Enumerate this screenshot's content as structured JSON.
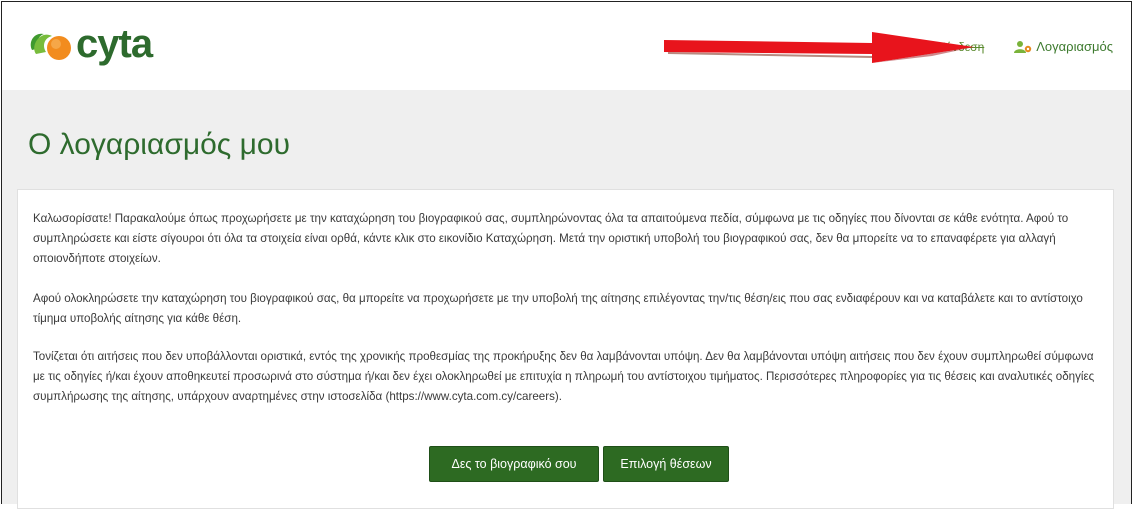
{
  "header": {
    "logo_text": "cyta",
    "struck_link": "Σύνδεση",
    "account_label": "Λογαριασμός"
  },
  "main": {
    "title": "Ο λογαριασμός μου",
    "paragraphs": [
      "Καλωσορίσατε! Παρακαλούμε όπως προχωρήσετε με την καταχώρηση του βιογραφικού σας, συμπληρώνοντας όλα τα απαιτούμενα πεδία, σύμφωνα με τις οδηγίες που δίνονται σε κάθε ενότητα. Αφού το συμπληρώσετε και είστε σίγουροι ότι όλα τα στοιχεία είναι ορθά, κάντε κλικ στο εικονίδιο Καταχώρηση. Μετά την οριστική υποβολή του βιογραφικού σας, δεν θα μπορείτε να το επαναφέρετε για αλλαγή οποιονδήποτε στοιχείων.",
      "Αφού ολοκληρώσετε την καταχώρηση του βιογραφικού σας, θα μπορείτε να προχωρήσετε με την υποβολή της αίτησης επιλέγοντας την/τις θέση/εις που σας ενδιαφέρουν και να καταβάλετε και το αντίστοιχο τίμημα υποβολής αίτησης για κάθε θέση.",
      "Τονίζεται ότι αιτήσεις που δεν υποβάλλονται οριστικά, εντός της χρονικής προθεσμίας της προκήρυξης δεν θα λαμβάνονται υπόψη. Δεν θα λαμβάνονται υπόψη αιτήσεις που δεν έχουν συμπληρωθεί σύμφωνα με τις οδηγίες ή/και έχουν αποθηκευτεί προσωρινά στο σύστημα ή/και δεν έχει ολοκληρωθεί με επιτυχία η πληρωμή του αντίστοιχου τιμήματος. Περισσότερες πληροφορίες για τις θέσεις και αναλυτικές οδηγίες συμπλήρωσης της αίτησης, υπάρχουν αναρτημένες στην ιστοσελίδα (https://www.cyta.com.cy/careers)."
    ],
    "btn_view_cv": "Δες το βιογραφικό σου",
    "btn_select_positions": "Επιλογή θέσεων"
  },
  "colors": {
    "brand_green": "#2d6a22",
    "annotation_arrow": "#e8141c"
  },
  "icons": [
    "cyta-logo-icon",
    "user-account-icon",
    "red-arrow-annotation"
  ]
}
